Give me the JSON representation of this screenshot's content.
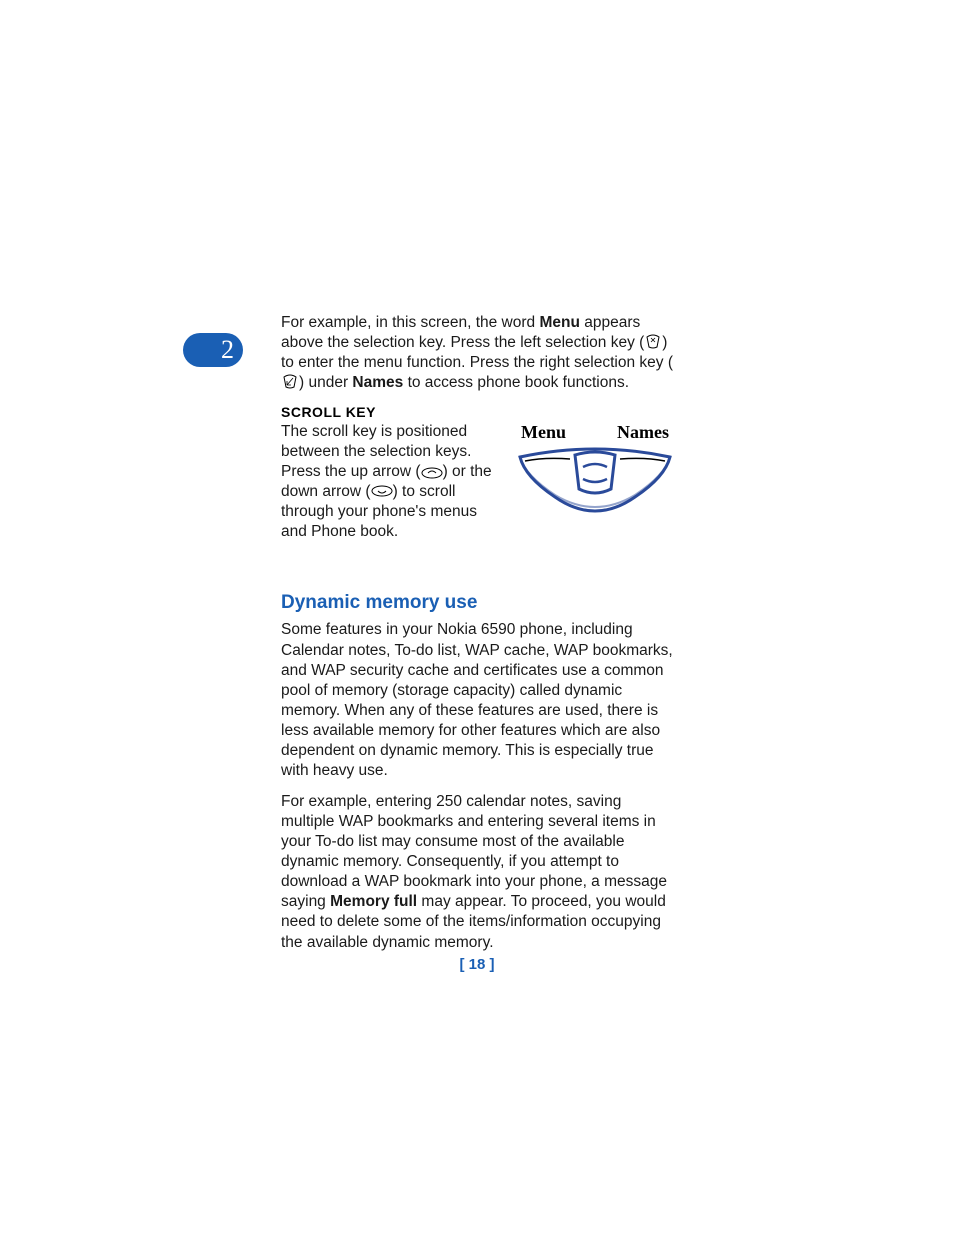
{
  "chapter_number": "2",
  "intro_para": {
    "pre_menu": "For example, in this screen, the word ",
    "menu_bold": "Menu",
    "post_menu_pre_icon1": " appears above the selection key. Press the left selection key (",
    "post_icon1": ") to enter the menu function. Press the right selection key (",
    "post_icon2_pre_names": ") under ",
    "names_bold": "Names",
    "post_names": " to access phone book functions."
  },
  "scroll_key": {
    "heading": "SCROLL KEY",
    "pre_up": "The scroll key is positioned between the selection keys. Press the up arrow (",
    "between": ") or the down arrow (",
    "post_down": ") to scroll through your phone's menus and Phone book."
  },
  "figure": {
    "left_label": "Menu",
    "right_label": "Names"
  },
  "section_title": "Dynamic memory use",
  "dyn_para_1": "Some features in your Nokia 6590 phone, including Calendar notes, To-do list, WAP cache, WAP bookmarks, and WAP security cache and certificates use a common pool of memory (storage capacity) called dynamic memory. When any of these features are used, there is less available memory for other features which are also dependent on dynamic memory. This is especially true with heavy use.",
  "dyn_para_2": {
    "pre_bold": "For example, entering 250 calendar notes, saving multiple WAP bookmarks and entering several items in your To-do list may consume most of the available dynamic memory. Consequently, if you attempt to download a WAP bookmark into your phone, a message saying ",
    "bold": "Memory full",
    "post_bold": " may appear. To proceed, you would need to delete some of the items/information occupying the available dynamic memory."
  },
  "footer": "[ 18 ]"
}
